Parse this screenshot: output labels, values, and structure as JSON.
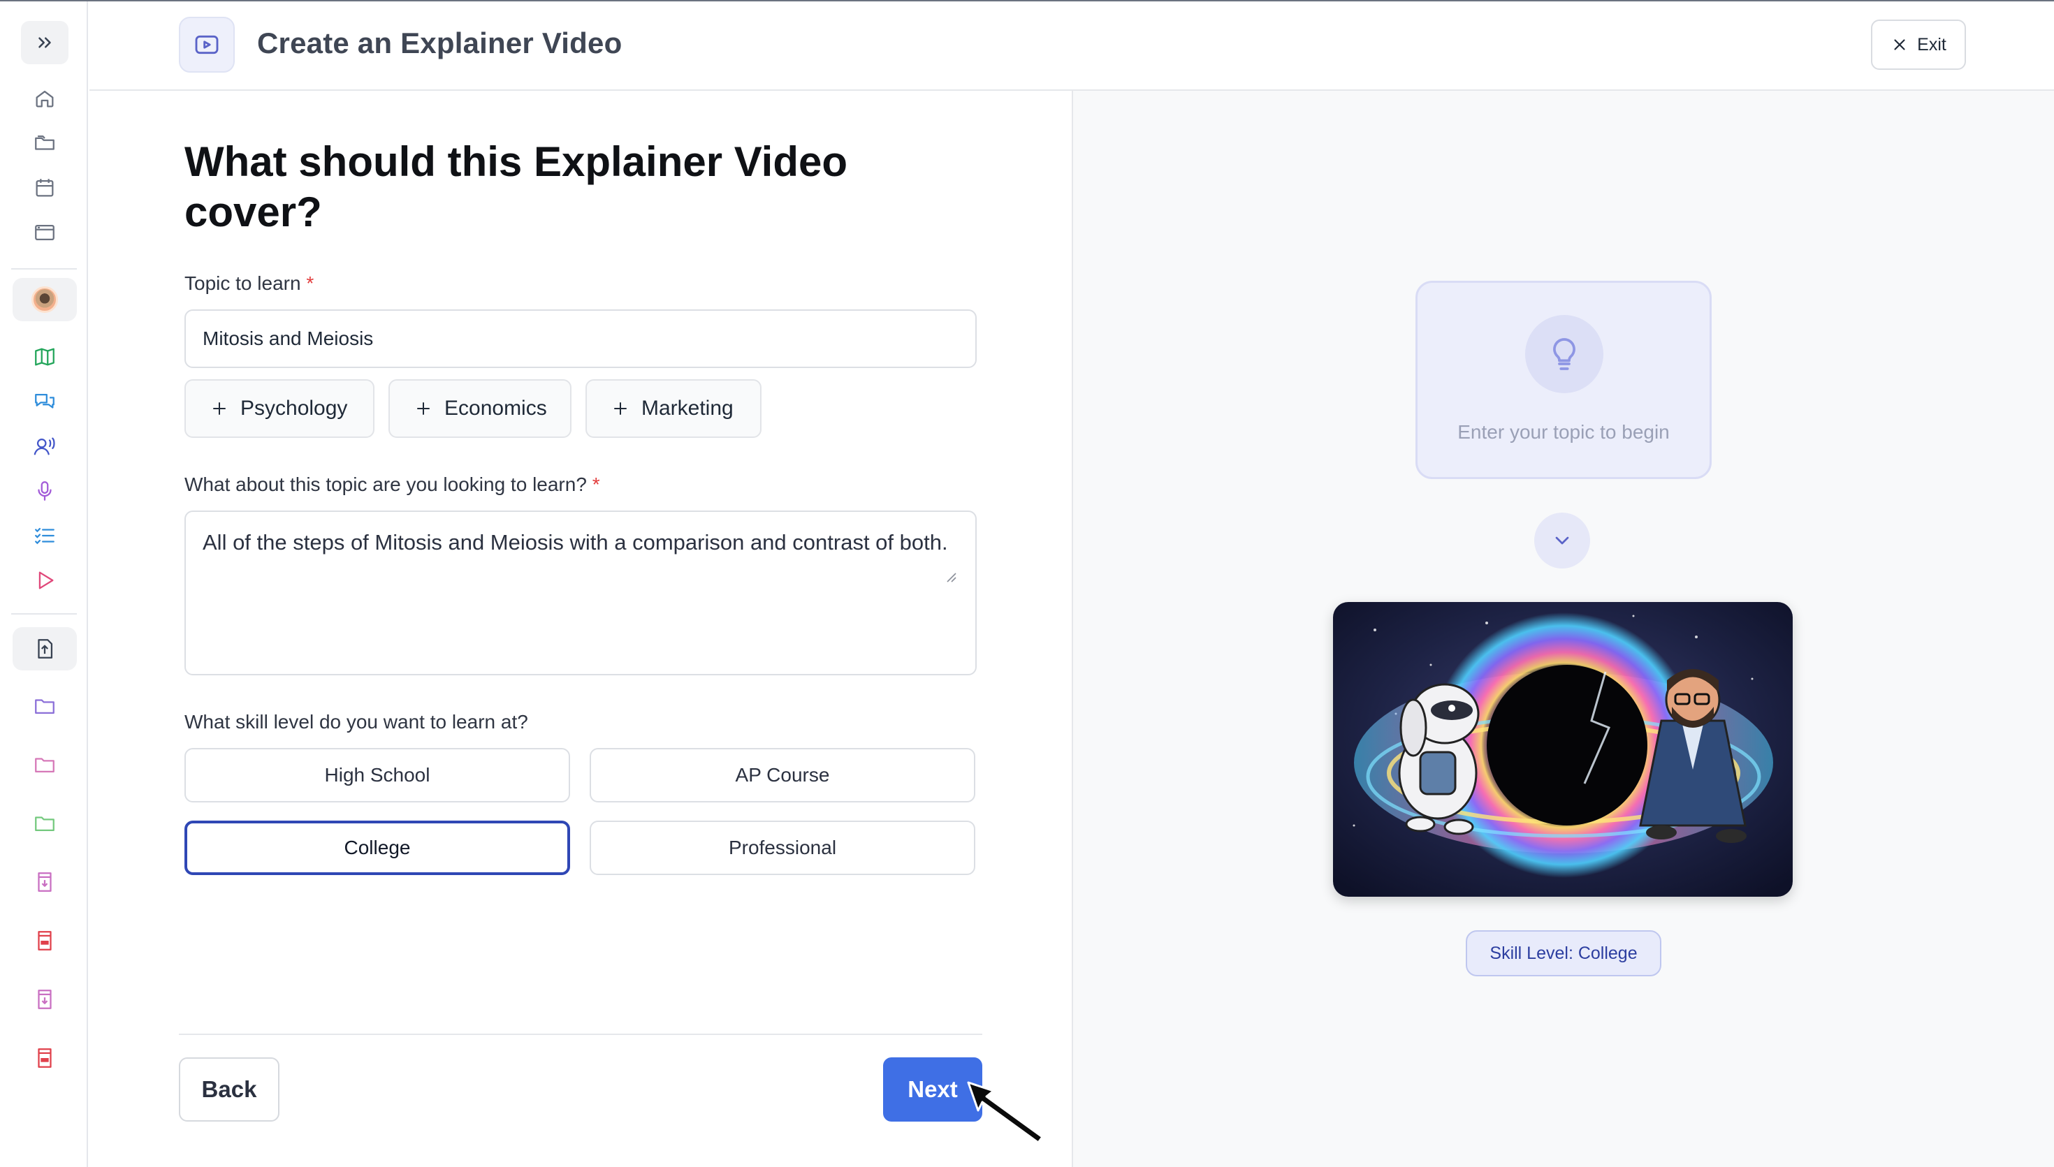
{
  "header": {
    "title": "Create an Explainer Video",
    "exit_label": "Exit"
  },
  "sidebar": {
    "icons": [
      "chevrons-right-icon",
      "home-icon",
      "folder-open-icon",
      "calendar-icon",
      "window-icon",
      "avatar-icon",
      "map-icon",
      "chat-icon",
      "voice-user-icon",
      "microphone-icon",
      "checklist-icon",
      "play-icon",
      "upload-file-icon",
      "folder-icon",
      "folder-icon",
      "folder-icon",
      "download-file-icon",
      "pdf-file-icon",
      "download-file-icon",
      "pdf-file-icon"
    ]
  },
  "form": {
    "title": "What should this Explainer Video cover?",
    "topic_label": "Topic to learn",
    "required_mark": "*",
    "topic_value": "Mitosis and Meiosis",
    "suggestions": [
      {
        "label": "Psychology"
      },
      {
        "label": "Economics"
      },
      {
        "label": "Marketing"
      }
    ],
    "focus_label": "What about this topic are you looking to learn?",
    "focus_value": "All of the steps of Mitosis and Meiosis with a comparison and contrast of both.",
    "skill_label": "What skill level do you want to learn at?",
    "skill_levels": [
      {
        "label": "High School"
      },
      {
        "label": "AP Course"
      },
      {
        "label": "College"
      },
      {
        "label": "Professional"
      }
    ],
    "selected_skill": "College",
    "back_label": "Back",
    "next_label": "Next"
  },
  "preview": {
    "topic_hint": "Enter your topic to begin",
    "skill_badge": "Skill Level: College"
  },
  "colors": {
    "primary": "#3f6fe5",
    "selected_border": "#2f47b5",
    "accent_light": "#eceefb",
    "required": "#e23d3d"
  }
}
